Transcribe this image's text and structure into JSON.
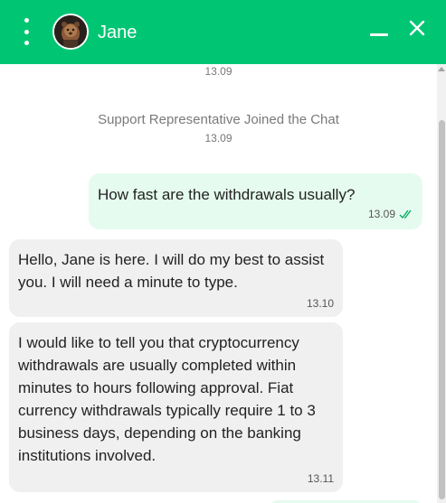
{
  "header": {
    "agent_name": "Jane",
    "background_color": "#00c674",
    "menu_icon": "vertical-dots-icon",
    "minimize_icon": "minimize-icon",
    "close_icon": "close-icon"
  },
  "messages": {
    "top_timestamp": "13.09",
    "system": {
      "text": "Support Representative Joined the Chat",
      "time": "13.09"
    },
    "outgoing_1": {
      "text": "How fast are the withdrawals usually?",
      "time": "13.09",
      "status_icon": "double-check-icon"
    },
    "incoming_1": {
      "text": "Hello, Jane is here. I will do my best to assist you. I will need a minute to type.",
      "time": "13.10"
    },
    "incoming_2": {
      "text": "I would like to tell you that cryptocurrency withdrawals are usually completed within minutes to hours following approval. Fiat currency withdrawals typically require 1 to 3 business days, depending on the banking institutions involved.",
      "time": "13.11"
    }
  }
}
